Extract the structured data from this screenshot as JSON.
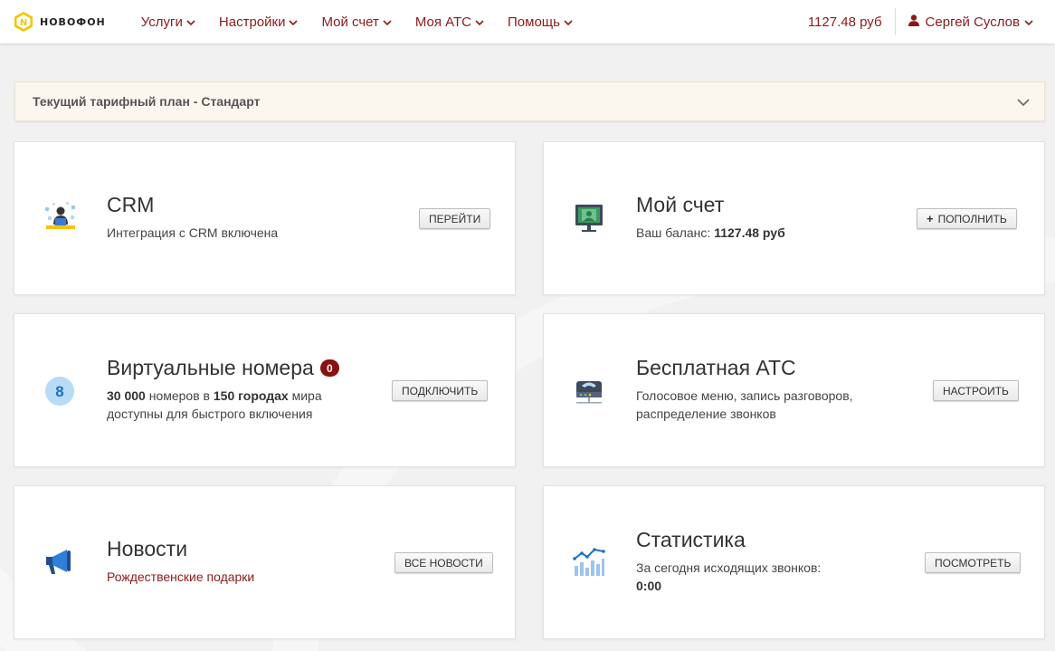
{
  "header": {
    "logo_text": "НОВОФОН",
    "nav": [
      {
        "label": "Услуги"
      },
      {
        "label": "Настройки"
      },
      {
        "label": "Мой счет"
      },
      {
        "label": "Моя АТС"
      },
      {
        "label": "Помощь"
      }
    ],
    "balance": "1127.48 руб",
    "user_name": "Сергей Суслов"
  },
  "tariff": {
    "label": "Текущий тарифный план - Стандарт"
  },
  "cards": {
    "crm": {
      "title": "CRM",
      "desc": "Интеграция с CRM включена",
      "button": "ПЕРЕЙТИ",
      "icon": "crm-icon"
    },
    "account": {
      "title": "Мой счет",
      "desc_prefix": "Ваш баланс:",
      "desc_value": "1127.48 руб",
      "button": "ПОПОЛНИТЬ",
      "icon": "monitor-money-icon"
    },
    "numbers": {
      "title": "Виртуальные номера",
      "badge": "0",
      "desc_num1": "30 000",
      "desc_mid": "номеров в",
      "desc_num2": "150 городах",
      "desc_tail": "мира",
      "desc_line2": "доступны для быстрого включения",
      "button": "ПОДКЛЮЧИТЬ",
      "icon_value": "8",
      "icon": "number-circle-icon"
    },
    "pbx": {
      "title": "Бесплатная АТС",
      "desc_line1": "Голосовое меню, запись разговоров,",
      "desc_line2": "распределение звонков",
      "button": "НАСТРОИТЬ",
      "icon": "phone-station-icon"
    },
    "news": {
      "title": "Новости",
      "link": "Рождественские подарки",
      "button": "ВСЕ НОВОСТИ",
      "icon": "megaphone-icon"
    },
    "stats": {
      "title": "Статистика",
      "desc_line1": "За сегодня исходящих звонков:",
      "desc_value": "0:00",
      "button": "ПОСМОТРЕТЬ",
      "icon": "chart-icon"
    }
  },
  "colors": {
    "accent": "#8b1a1a",
    "logo_yellow": "#f5c400",
    "tariff_bg": "#fcf7ee",
    "badge": "#8b1010"
  }
}
